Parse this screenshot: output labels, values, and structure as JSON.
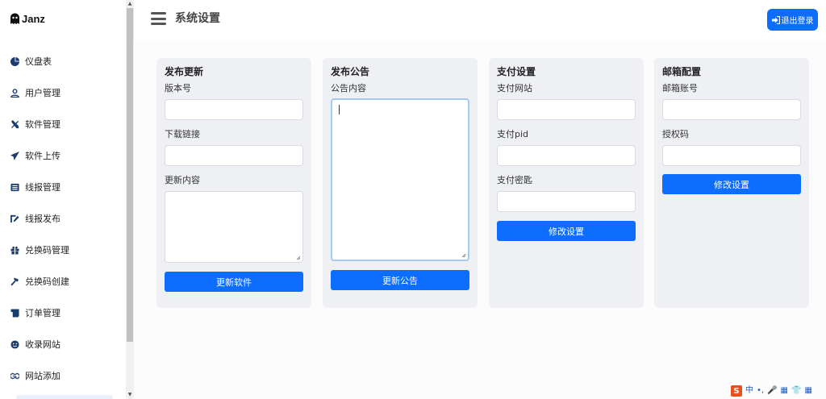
{
  "sidebar": {
    "brand": "Janz",
    "items": [
      {
        "label": "仪盘表",
        "icon": "pie-chart-icon"
      },
      {
        "label": "用户管理",
        "icon": "user-icon"
      },
      {
        "label": "软件管理",
        "icon": "tools-icon"
      },
      {
        "label": "软件上传",
        "icon": "paper-plane-icon"
      },
      {
        "label": "线报管理",
        "icon": "list-icon"
      },
      {
        "label": "线报发布",
        "icon": "edit-icon"
      },
      {
        "label": "兑换码管理",
        "icon": "gift-icon"
      },
      {
        "label": "兑换码创建",
        "icon": "hammer-icon"
      },
      {
        "label": "订单管理",
        "icon": "scroll-icon"
      },
      {
        "label": "收录网站",
        "icon": "smile-icon"
      },
      {
        "label": "网站添加",
        "icon": "handshake-icon"
      }
    ]
  },
  "header": {
    "title": "系统设置",
    "logout_label": "退出登录"
  },
  "cards": {
    "update": {
      "title": "发布更新",
      "version_label": "版本号",
      "version_value": "",
      "link_label": "下载链接",
      "link_value": "",
      "content_label": "更新内容",
      "content_value": "",
      "button": "更新软件"
    },
    "notice": {
      "title": "发布公告",
      "content_label": "公告内容",
      "content_value": "",
      "button": "更新公告"
    },
    "payment": {
      "title": "支付设置",
      "site_label": "支付网站",
      "site_value": "",
      "pid_label": "支付pid",
      "pid_value": "",
      "key_label": "支付密匙",
      "key_value": "",
      "button": "修改设置"
    },
    "mail": {
      "title": "邮箱配置",
      "account_label": "邮箱账号",
      "account_value": "",
      "auth_label": "授权码",
      "auth_value": "",
      "button": "修改设置"
    }
  },
  "ime": {
    "items": [
      "中",
      "•,",
      "🎤",
      "▦",
      "👕",
      "▦"
    ]
  },
  "colors": {
    "primary": "#0d6efd",
    "card_bg": "#eef0f3",
    "ime_brand": "#e8501c"
  }
}
